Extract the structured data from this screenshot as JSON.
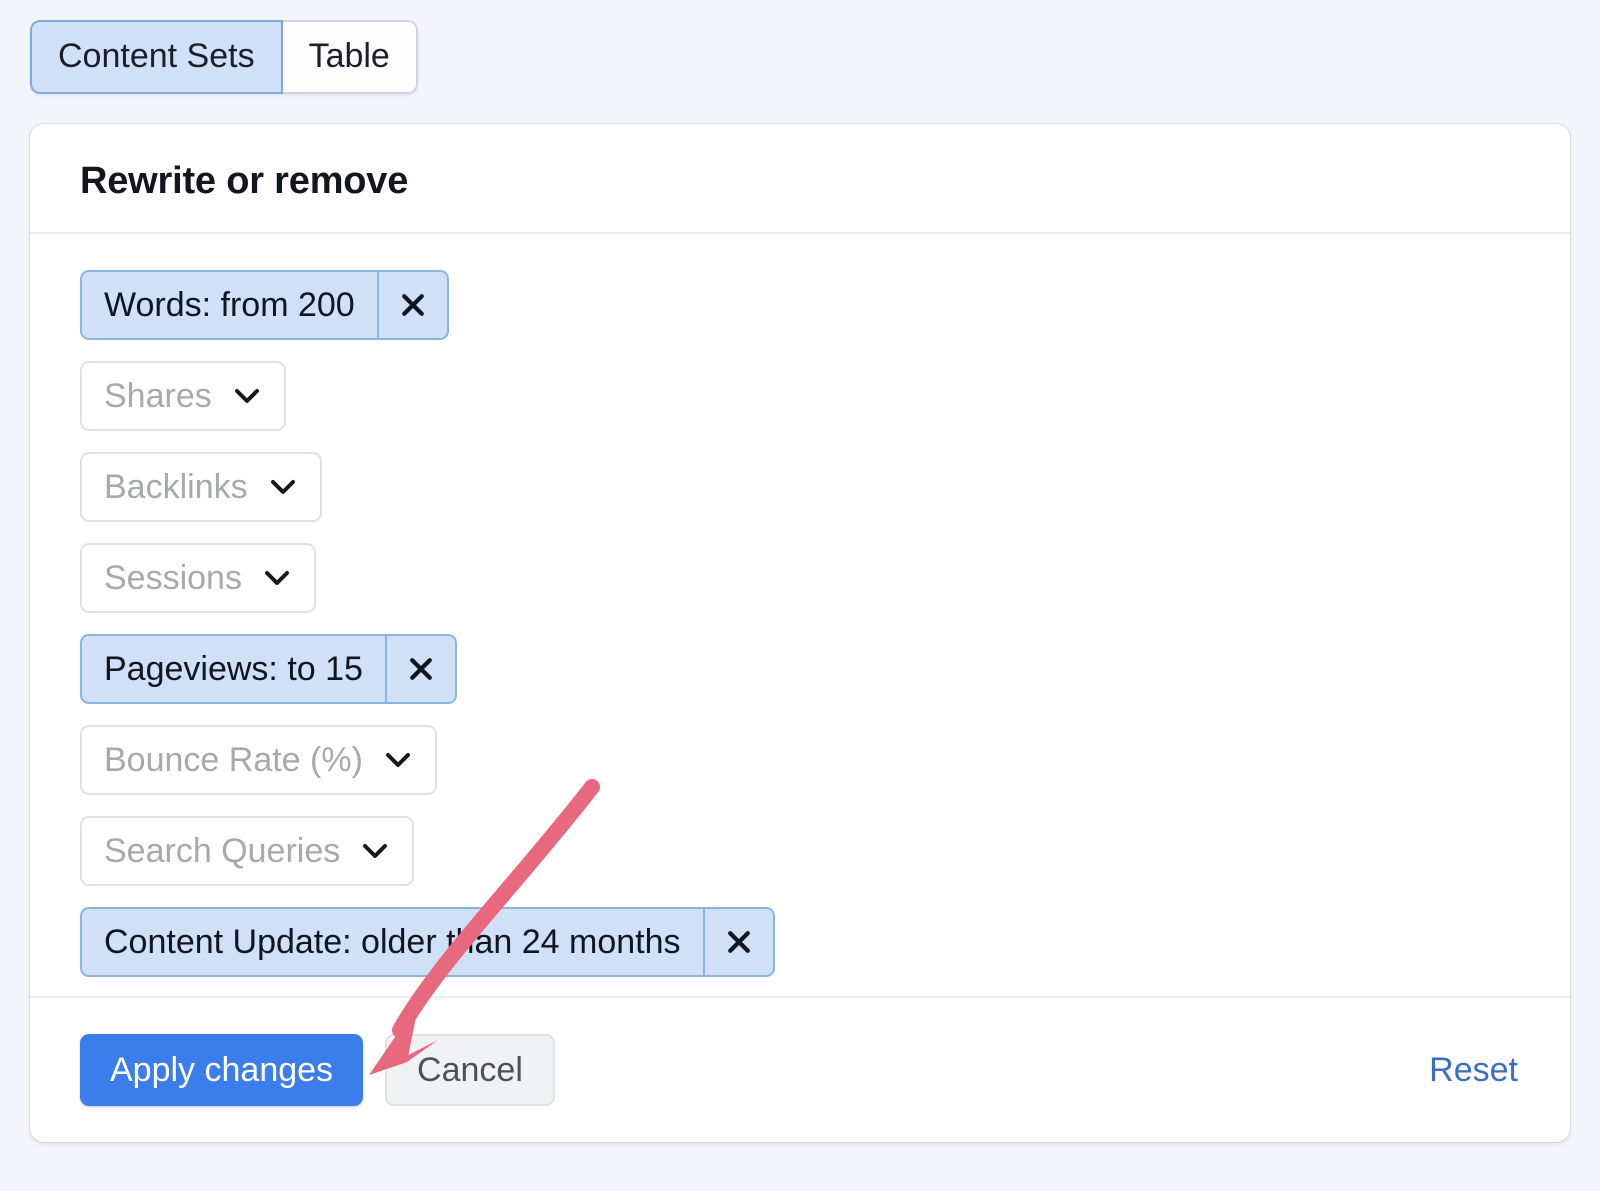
{
  "view_toggle": {
    "options": [
      {
        "label": "Content Sets",
        "active": true
      },
      {
        "label": "Table",
        "active": false
      }
    ]
  },
  "panel": {
    "title": "Rewrite or remove",
    "filters": [
      {
        "type": "chip",
        "label": "Words: from 200",
        "close_icon": "close-icon"
      },
      {
        "type": "dropdown",
        "label": "Shares",
        "icon": "chevron-down-icon"
      },
      {
        "type": "dropdown",
        "label": "Backlinks",
        "icon": "chevron-down-icon"
      },
      {
        "type": "dropdown",
        "label": "Sessions",
        "icon": "chevron-down-icon"
      },
      {
        "type": "chip",
        "label": "Pageviews: to 15",
        "close_icon": "close-icon"
      },
      {
        "type": "dropdown",
        "label": "Bounce Rate (%)",
        "icon": "chevron-down-icon"
      },
      {
        "type": "dropdown",
        "label": "Search Queries",
        "icon": "chevron-down-icon"
      },
      {
        "type": "chip",
        "label": "Content Update: older than 24 months",
        "close_icon": "close-icon"
      }
    ],
    "footer": {
      "apply_label": "Apply changes",
      "cancel_label": "Cancel",
      "reset_label": "Reset"
    }
  },
  "annotation": {
    "type": "curved-arrow",
    "color": "#e8687e",
    "points_to": "Apply changes"
  },
  "colors": {
    "page_background": "#f4f4fb",
    "card_background": "#ffffff",
    "chip_fill": "#cfe0f7",
    "chip_border": "#8bb3e0",
    "primary_button": "#3b7eeb",
    "link": "#3b6fc4",
    "placeholder_text": "#a8a9ad",
    "arrow": "#e8687e"
  }
}
